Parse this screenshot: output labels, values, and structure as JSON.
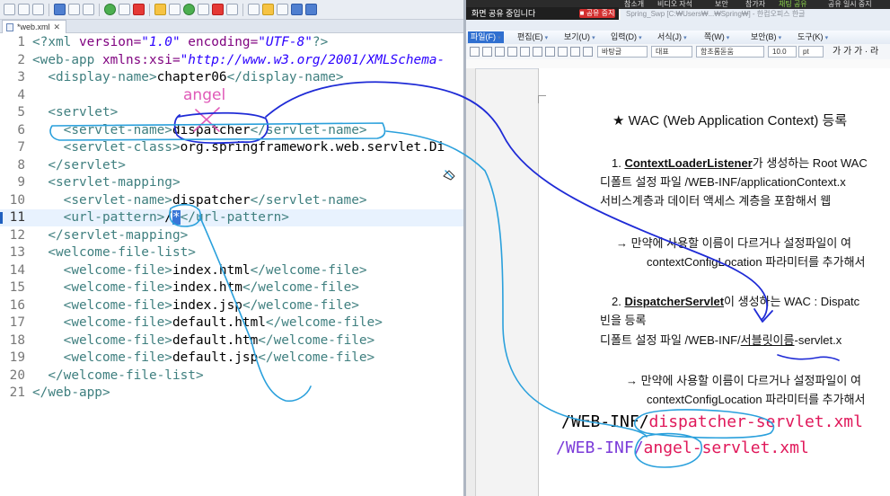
{
  "ide": {
    "tab_label": "*web.xml",
    "tab_close": "✕",
    "lines": [
      {
        "no": "1",
        "html": "<span class='t-decl'>&lt;?xml </span><span class='t-attr'>version=</span><span class='t-val'>\"1.0\"</span><span class='t-attr'> encoding=</span><span class='t-val'>\"UTF-8\"</span><span class='t-decl'>?&gt;</span>"
      },
      {
        "no": "2",
        "html": "<span class='t-tag'>&lt;web-app </span><span class='t-attr'>xmlns:xsi=</span><span class='t-val'>\"http://www.w3.org/2001/XMLSchema-</span>"
      },
      {
        "no": "3",
        "html": "  <span class='t-tag'>&lt;display-name&gt;</span><span class='t-text'>chapter06</span><span class='t-tag'>&lt;/display-name&gt;</span>"
      },
      {
        "no": "4",
        "html": ""
      },
      {
        "no": "5",
        "html": "  <span class='t-tag'>&lt;servlet&gt;</span>"
      },
      {
        "no": "6",
        "html": "    <span class='t-tag'>&lt;servlet-name&gt;</span><span class='t-text'>dispatcher</span><span class='t-tag'>&lt;/servlet-name&gt;</span>"
      },
      {
        "no": "7",
        "html": "    <span class='t-tag'>&lt;servlet-class&gt;</span><span class='t-text'>org.springframework.web.servlet.Di</span>"
      },
      {
        "no": "8",
        "html": "  <span class='t-tag'>&lt;/servlet&gt;</span>"
      },
      {
        "no": "9",
        "html": "  <span class='t-tag'>&lt;servlet-mapping&gt;</span>"
      },
      {
        "no": "10",
        "html": "    <span class='t-tag'>&lt;servlet-name&gt;</span><span class='t-text'>dispatcher</span><span class='t-tag'>&lt;/servlet-name&gt;</span>"
      },
      {
        "no": "11",
        "html": "    <span class='t-tag'>&lt;url-pattern&gt;</span><span class='t-text'>/</span><span class='t-sel'>*</span><span class='t-tag'>&lt;/url-pattern&gt;</span>"
      },
      {
        "no": "12",
        "html": "  <span class='t-tag'>&lt;/servlet-mapping&gt;</span>"
      },
      {
        "no": "13",
        "html": "  <span class='t-tag'>&lt;welcome-file-list&gt;</span>"
      },
      {
        "no": "14",
        "html": "    <span class='t-tag'>&lt;welcome-file&gt;</span><span class='t-text'>index.html</span><span class='t-tag'>&lt;/welcome-file&gt;</span>"
      },
      {
        "no": "15",
        "html": "    <span class='t-tag'>&lt;welcome-file&gt;</span><span class='t-text'>index.htm</span><span class='t-tag'>&lt;/welcome-file&gt;</span>"
      },
      {
        "no": "16",
        "html": "    <span class='t-tag'>&lt;welcome-file&gt;</span><span class='t-text'>index.jsp</span><span class='t-tag'>&lt;/welcome-file&gt;</span>"
      },
      {
        "no": "17",
        "html": "    <span class='t-tag'>&lt;welcome-file&gt;</span><span class='t-text'>default.html</span><span class='t-tag'>&lt;/welcome-file&gt;</span>"
      },
      {
        "no": "18",
        "html": "    <span class='t-tag'>&lt;welcome-file&gt;</span><span class='t-text'>default.htm</span><span class='t-tag'>&lt;/welcome-file&gt;</span>"
      },
      {
        "no": "19",
        "html": "    <span class='t-tag'>&lt;welcome-file&gt;</span><span class='t-text'>default.jsp</span><span class='t-tag'>&lt;/welcome-file&gt;</span>"
      },
      {
        "no": "20",
        "html": "  <span class='t-tag'>&lt;/welcome-file-list&gt;</span>"
      },
      {
        "no": "21",
        "html": "<span class='t-tag'>&lt;/web-app&gt;</span>"
      }
    ],
    "current_line": "11",
    "annotation_angel": "angel"
  },
  "share": {
    "items": [
      "참소개",
      "비디오 자석",
      "보안",
      "참가자",
      "채팅 공유",
      "공유 일시 중지",
      "주석 작성",
      "원격 제어",
      "더 보기"
    ],
    "active_item": "채팅 공유",
    "status": "화면 공유 중입니다",
    "stop_label": "■ 공유 중지"
  },
  "wp": {
    "title": "Spring_Swp [C:₩Users₩...₩Spring₩] - 한컴오피스 한글",
    "menus": [
      {
        "label": "파일(F)",
        "active": true
      },
      {
        "label": "편집(E)",
        "active": false
      },
      {
        "label": "보기(U)",
        "active": false
      },
      {
        "label": "입력(D)",
        "active": false
      },
      {
        "label": "서식(J)",
        "active": false
      },
      {
        "label": "쪽(W)",
        "active": false
      },
      {
        "label": "보안(B)",
        "active": false
      },
      {
        "label": "도구(K)",
        "active": false
      }
    ],
    "style_combo": "바탕글",
    "font_lang_combo": "대표",
    "font_combo": "함초롬돋움",
    "size_combo": "10.0",
    "size_unit": "pt",
    "format_buttons": "가 가 가 · 라",
    "doc": {
      "heading": "★ WAC (Web Application Context) 등록",
      "p1_num": "1. ",
      "p1_bold": "ContextLoaderListener",
      "p1_rest": "가 생성하는 Root WAC",
      "p1_line2": "디폴트 설정 파일 /WEB-INF/applicationContext.x",
      "p1_line3": "서비스계층과 데이터 액세스 계층을 포함해서 웹 ",
      "p1_note1": "→ 만약에 사용할 이름이 다르거나 설정파일이 여",
      "p1_note2": "contextConfigLocation 파라미터를 추가해서",
      "p2_num": "2. ",
      "p2_bold": "DispatcherServlet",
      "p2_rest": "이 생성하는 WAC : Dispatc",
      "p2_line2": "빈을 등록",
      "p2_line3_a": "디폴트 설정 파일 /WEB-INF/",
      "p2_line3_b": "서블릿이름",
      "p2_line3_c": "-servlet.x",
      "p2_note1": "→ 만약에 사용할 이름이 다르거나 설정파일이 여",
      "p2_note2": "contextConfigLocation 파라미터를 추가해서",
      "hand1_a": "/WEB-INF/",
      "hand1_b": "dispatcher-servlet.xml",
      "hand2_a": "/WEB-INF/",
      "hand2_b": "angel-servlet.xml"
    }
  }
}
